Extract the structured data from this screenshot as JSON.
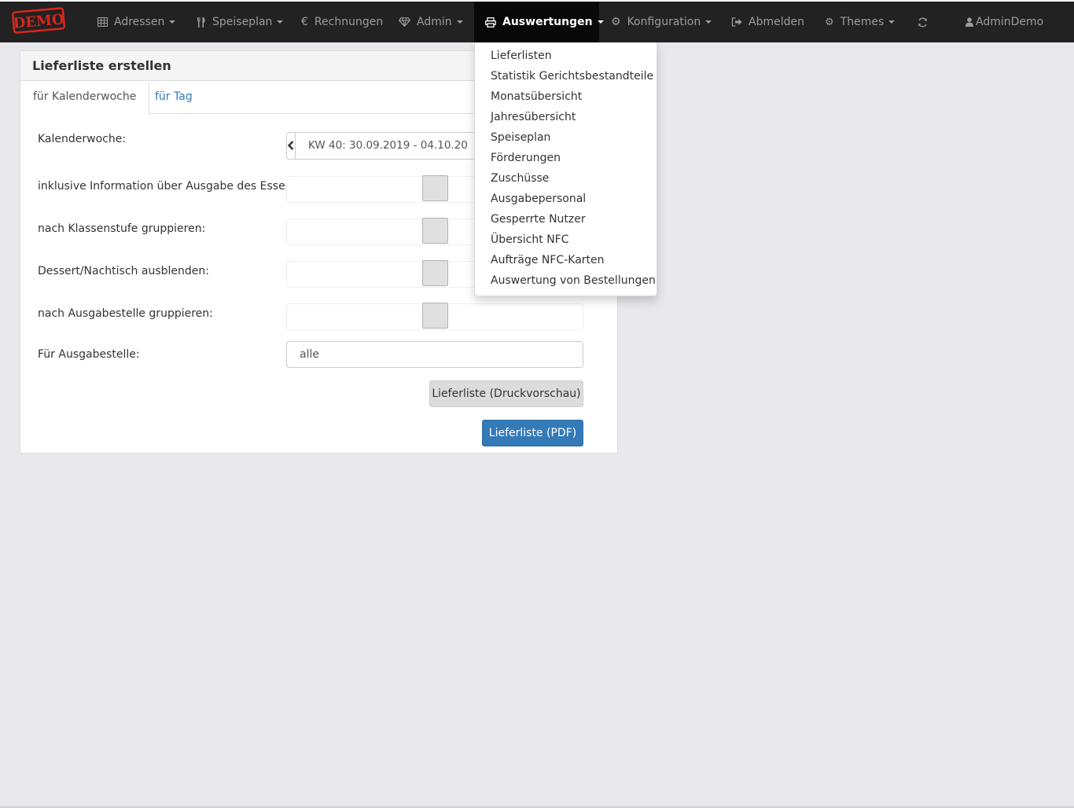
{
  "logo_text": "DEMO",
  "nav": {
    "items": [
      {
        "label": "Adressen",
        "icon": "table-icon"
      },
      {
        "label": "Speiseplan",
        "icon": "cutlery-icon"
      },
      {
        "label": "Rechnungen",
        "icon": "euro-icon"
      },
      {
        "label": "Admin",
        "icon": "diamond-icon"
      },
      {
        "label": "Auswertungen",
        "icon": "print-icon"
      },
      {
        "label": "Konfiguration",
        "icon": "gear-icon"
      },
      {
        "label": "Abmelden",
        "icon": "logout-icon"
      },
      {
        "label": "Themes",
        "icon": "cogs-icon"
      },
      {
        "label": "",
        "icon": "refresh-icon"
      },
      {
        "label": "AdminDemo",
        "icon": "user-icon"
      }
    ]
  },
  "panel": {
    "title": "Lieferliste erstellen",
    "tabs": [
      "für Kalenderwoche",
      "für Tag"
    ],
    "week_label": "Kalenderwoche:",
    "week_value": "KW 40: 30.09.2019 - 04.10.20",
    "options": [
      "inklusive Information über Ausgabe des Essens:",
      "nach Klassenstufe gruppieren:",
      "Dessert/Nachtisch ausblenden:",
      "nach Ausgabestelle gruppieren:"
    ],
    "outlet_label": "Für Ausgabestelle:",
    "outlet_value": "alle",
    "btn_preview": "Lieferliste (Druckvorschau)",
    "btn_pdf": "Lieferliste (PDF)"
  },
  "dropdown": {
    "items": [
      "Lieferlisten",
      "Statistik Gerichtsbestandteile",
      "Monatsübersicht",
      "Jahresübersicht",
      "Speiseplan",
      "Förderungen",
      "Zuschüsse",
      "Ausgabepersonal",
      "Gesperrte Nutzer",
      "Übersicht NFC",
      "Aufträge NFC-Karten",
      "Auswertung von Bestellungen"
    ]
  },
  "colors": {
    "navbar": "#222222",
    "active_nav": "#080808",
    "primary": "#337ab7",
    "logo_red": "#d9261c"
  }
}
